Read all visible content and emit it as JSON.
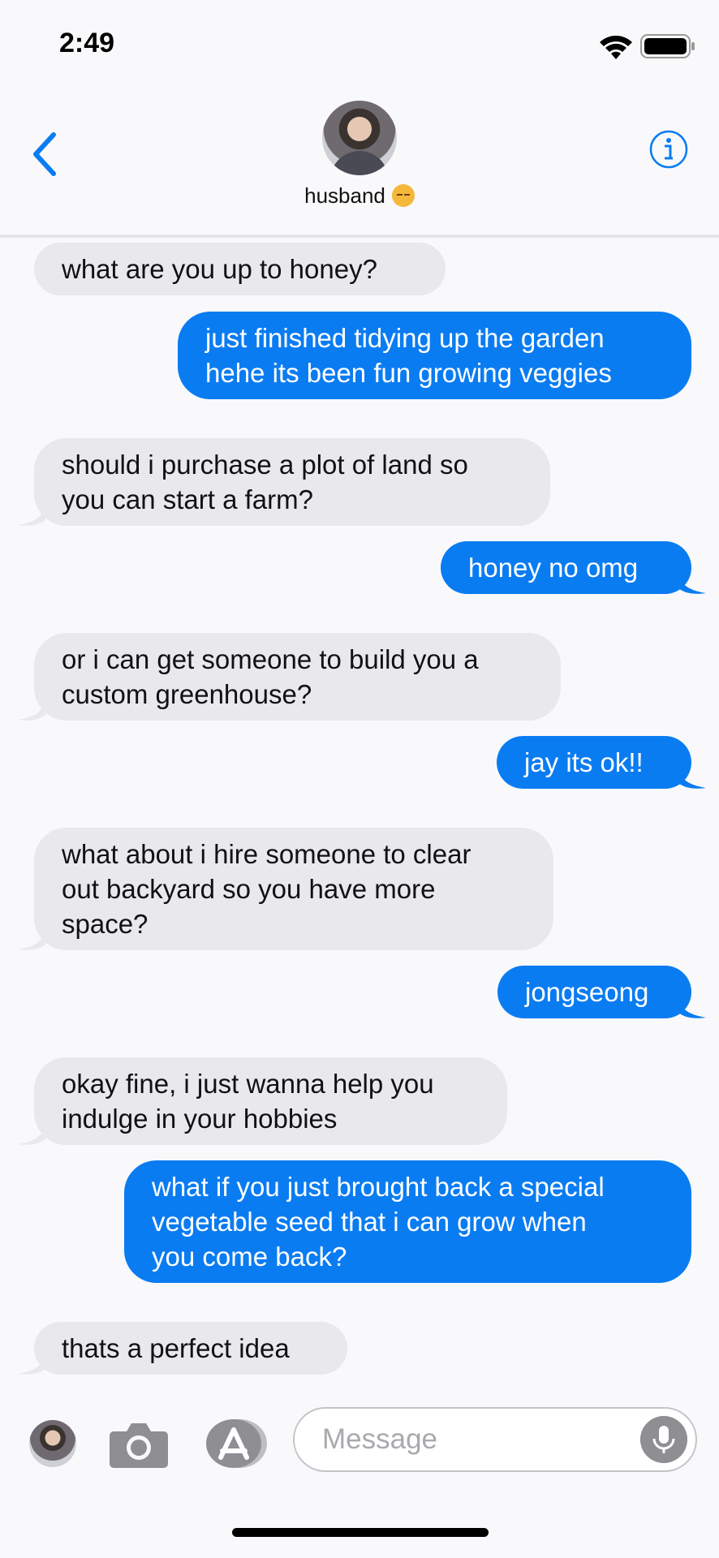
{
  "status_bar": {
    "time": "2:49"
  },
  "header": {
    "contact_name": "husband",
    "contact_emoji": "pensive-face"
  },
  "messages": [
    {
      "from": "them",
      "text_lines": [
        "what are you up to honey?"
      ]
    },
    {
      "from": "me",
      "text_lines": [
        "just finished tidying up the garden",
        "hehe its been fun growing veggies"
      ]
    },
    {
      "from": "them",
      "text_lines": [
        "should i purchase a plot of land so",
        "you can start a farm?"
      ]
    },
    {
      "from": "me",
      "text_lines": [
        "honey no omg"
      ]
    },
    {
      "from": "them",
      "text_lines": [
        "or i can get someone to build you a",
        "custom greenhouse?"
      ]
    },
    {
      "from": "me",
      "text_lines": [
        "jay its ok!!"
      ]
    },
    {
      "from": "them",
      "text_lines": [
        "what about i hire someone to clear",
        "out backyard so you have more",
        "space?"
      ]
    },
    {
      "from": "me",
      "text_lines": [
        "jongseong"
      ]
    },
    {
      "from": "them",
      "text_lines": [
        "okay fine, i just wanna help you",
        "indulge in your hobbies"
      ]
    },
    {
      "from": "me",
      "text_lines": [
        "what if you just brought back a special",
        "vegetable seed that i can grow when",
        "you come back?"
      ]
    },
    {
      "from": "them",
      "text_lines": [
        "thats a perfect idea"
      ]
    }
  ],
  "composer": {
    "placeholder": "Message"
  },
  "colors": {
    "outgoing": "#0a7cf2",
    "incoming": "#e9e8ed",
    "accent": "#0a7cf2"
  }
}
